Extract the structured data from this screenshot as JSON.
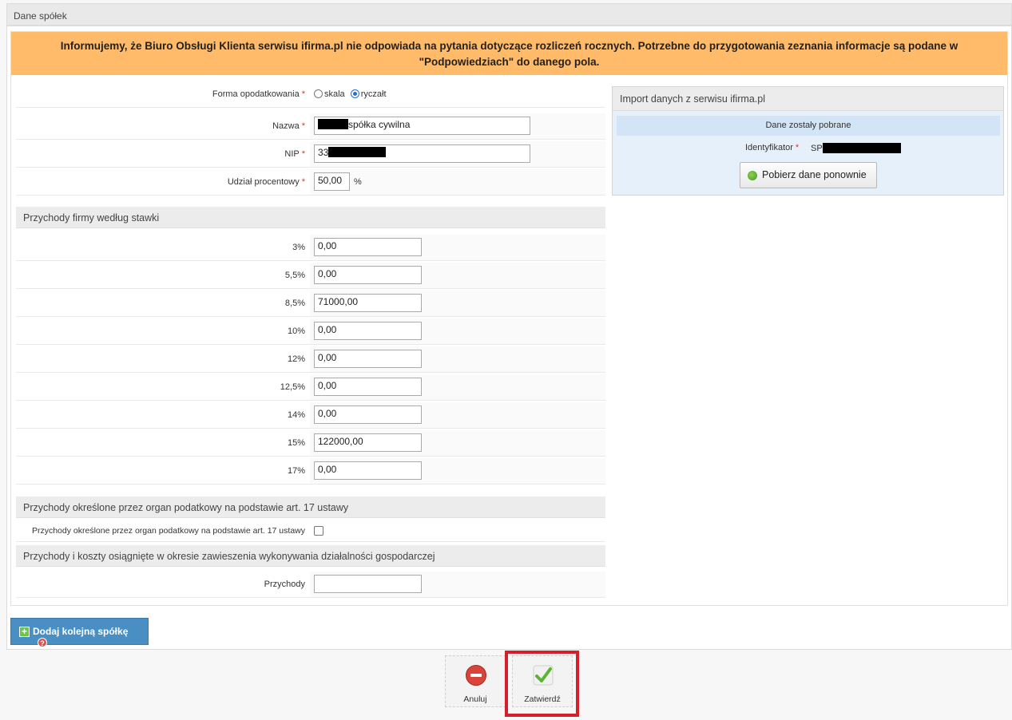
{
  "header": {
    "title": "Dane spółek"
  },
  "notice": {
    "text": "Informujemy, że Biuro Obsługi Klienta serwisu ifirma.pl nie odpowiada na pytania dotyczące rozliczeń rocznych. Potrzebne do przygotowania zeznania informacje są podane w \"Podpowiedziach\" do danego pola."
  },
  "form": {
    "tax_form_label": "Forma opodatkowania",
    "tax_options": [
      {
        "label": "skala",
        "checked": false
      },
      {
        "label": "ryczałt",
        "checked": true
      }
    ],
    "name_label": "Nazwa",
    "name_value_visible": "spółka cywilna",
    "nip_label": "NIP",
    "nip_value_visible": "33",
    "share_label": "Udział procentowy",
    "share_value": "50,00",
    "share_unit": "%"
  },
  "rates_section": {
    "title": "Przychody firmy według stawki",
    "rows": [
      {
        "label": "3%",
        "value": "0,00"
      },
      {
        "label": "5,5%",
        "value": "0,00"
      },
      {
        "label": "8,5%",
        "value": "71000,00"
      },
      {
        "label": "10%",
        "value": "0,00"
      },
      {
        "label": "12%",
        "value": "0,00"
      },
      {
        "label": "12,5%",
        "value": "0,00"
      },
      {
        "label": "14%",
        "value": "0,00"
      },
      {
        "label": "15%",
        "value": "122000,00"
      },
      {
        "label": "17%",
        "value": "0,00"
      }
    ]
  },
  "art17_section": {
    "title": "Przychody określone przez organ podatkowy na podstawie art. 17 ustawy",
    "checkbox_label": "Przychody określone przez organ podatkowy na podstawie art. 17 ustawy",
    "checked": false
  },
  "suspension_section": {
    "title": "Przychody i koszty osiągnięte w okresie zawieszenia wykonywania działalności gospodarczej",
    "income_label": "Przychody",
    "income_value": ""
  },
  "import_panel": {
    "title": "Import danych z serwisu ifirma.pl",
    "status": "Dane zostały pobrane",
    "identifier_label": "Identyfikator",
    "identifier_visible": "SP",
    "refresh_button": "Pobierz dane ponownie"
  },
  "actions": {
    "add_company": "Dodaj kolejną spółkę",
    "cancel": "Anuluj",
    "confirm": "Zatwierdź"
  },
  "colors": {
    "notice_bg": "#ffba6a",
    "add_button_bg": "#4a8fc3",
    "highlight_border": "#d3202a",
    "required_mark": "#d33"
  },
  "icons": {
    "refresh": "refresh-icon",
    "add": "plus-icon",
    "help": "help-icon",
    "cancel": "cancel-icon",
    "confirm": "checkmark-icon"
  }
}
